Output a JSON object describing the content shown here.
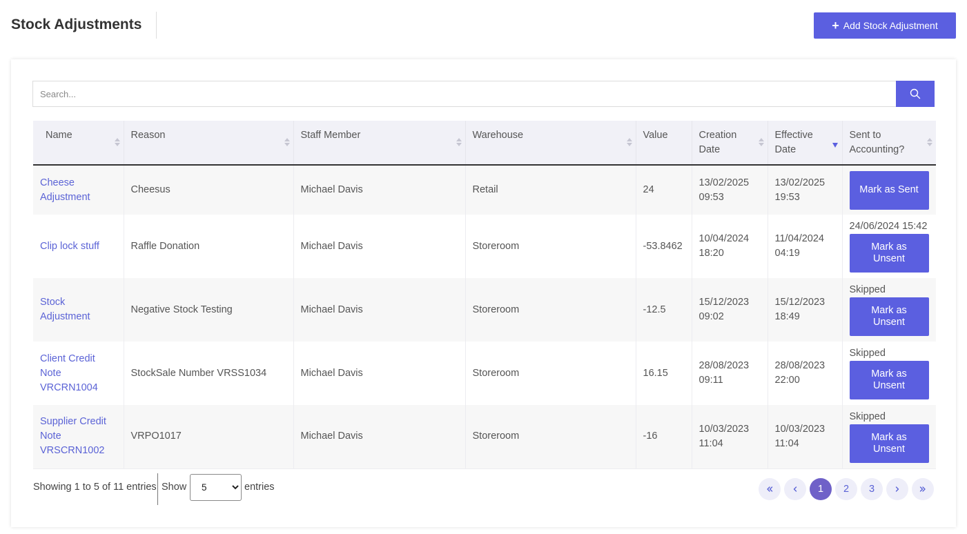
{
  "header": {
    "title": "Stock Adjustments",
    "add_button_label": "Add Stock Adjustment"
  },
  "search": {
    "placeholder": "Search...",
    "value": ""
  },
  "table": {
    "columns": [
      {
        "label": "Name"
      },
      {
        "label": "Reason"
      },
      {
        "label": "Staff Member"
      },
      {
        "label": "Warehouse"
      },
      {
        "label": "Value"
      },
      {
        "label": "Creation Date"
      },
      {
        "label": "Effective Date",
        "sorted": "desc"
      },
      {
        "label": "Sent to Accounting?"
      }
    ],
    "rows": [
      {
        "name": "Cheese Adjustment",
        "reason": "Cheesus",
        "staff": "Michael Davis",
        "warehouse": "Retail",
        "value": "24",
        "created": "13/02/2025 09:53",
        "effective": "13/02/2025 19:53",
        "sent_status": "",
        "action": "Mark as Sent"
      },
      {
        "name": "Clip lock stuff",
        "reason": "Raffle Donation",
        "staff": "Michael Davis",
        "warehouse": "Storeroom",
        "value": "-53.8462",
        "created": "10/04/2024 18:20",
        "effective": "11/04/2024 04:19",
        "sent_status": "24/06/2024 15:42",
        "action": "Mark as Unsent"
      },
      {
        "name": "Stock Adjustment",
        "reason": "Negative Stock Testing",
        "staff": "Michael Davis",
        "warehouse": "Storeroom",
        "value": "-12.5",
        "created": "15/12/2023 09:02",
        "effective": "15/12/2023 18:49",
        "sent_status": "Skipped",
        "action": "Mark as Unsent"
      },
      {
        "name": "Client Credit Note VRCRN1004",
        "reason": "StockSale Number VRSS1034",
        "staff": "Michael Davis",
        "warehouse": "Storeroom",
        "value": "16.15",
        "created": "28/08/2023 09:11",
        "effective": "28/08/2023 22:00",
        "sent_status": "Skipped",
        "action": "Mark as Unsent"
      },
      {
        "name": "Supplier Credit Note VRSCRN1002",
        "reason": "VRPO1017",
        "staff": "Michael Davis",
        "warehouse": "Storeroom",
        "value": "-16",
        "created": "10/03/2023 11:04",
        "effective": "10/03/2023 11:04",
        "sent_status": "Skipped",
        "action": "Mark as Unsent"
      }
    ]
  },
  "footer": {
    "info": "Showing 1 to 5 of 11 entries",
    "show_label": "Show",
    "page_size": "5",
    "entries_label": "entries"
  },
  "pagination": {
    "first_icon": "double-chevron-left-icon",
    "prev_icon": "chevron-left-icon",
    "pages": [
      "1",
      "2",
      "3"
    ],
    "current": "1",
    "next_icon": "chevron-right-icon",
    "last_icon": "double-chevron-right-icon"
  },
  "colors": {
    "accent": "#5b5fe0",
    "active_page": "#6f61c8",
    "link": "#5b63d6"
  }
}
